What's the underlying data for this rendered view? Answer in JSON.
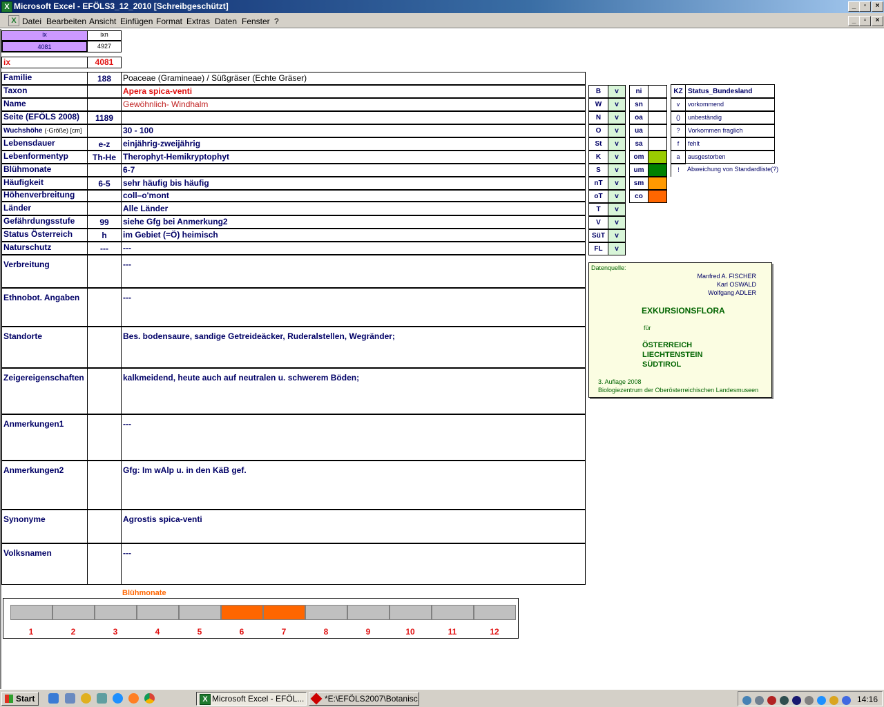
{
  "window": {
    "title": "Microsoft Excel - EFÖLS3_12_2010  [Schreibgeschützt]",
    "btn_min": "_",
    "btn_max": "▫",
    "btn_close": "×"
  },
  "menu": [
    "Datei",
    "Bearbeiten",
    "Ansicht",
    "Einfügen",
    "Format",
    "Extras",
    "Daten",
    "Fenster",
    "?"
  ],
  "header": {
    "ix_label": "ix",
    "ixn_label": "ixn",
    "ix_value": "4081",
    "ixn_value": "4927",
    "ix2_label": "ix",
    "ix2_value": "4081"
  },
  "rows": [
    {
      "label": "Familie",
      "code": "188",
      "value": "Poaceae (Gramineae)  /  Süßgräser (Echte Gräser)"
    },
    {
      "label": "Taxon",
      "code": "",
      "value": "Apera spica-venti"
    },
    {
      "label": "Name",
      "code": "",
      "value": "Gewöhnlich- Windhalm"
    },
    {
      "label": "Seite (EFÖLS 2008)",
      "code": "1189",
      "value": ""
    },
    {
      "label": "Wuchshöhe",
      "label_suffix": "(-Größe) [cm]",
      "code": "",
      "value": " 30 - 100"
    },
    {
      "label": "Lebensdauer",
      "code": "e-z",
      "value": "einjährig-zweijährig"
    },
    {
      "label": "Lebenformentyp",
      "code": "Th-He",
      "value": "Therophyt-Hemikryptophyt"
    },
    {
      "label": "Blühmonate",
      "code": "",
      "value": " 6-7"
    },
    {
      "label": "Häufigkeit",
      "code": "6-5",
      "value": "sehr häufig bis häufig"
    },
    {
      "label": "Höhenverbreitung",
      "code": "",
      "value": "coll–o'mont"
    },
    {
      "label": "Länder",
      "code": "",
      "value": "Alle Länder"
    },
    {
      "label": "Gefährdungsstufe",
      "code": "99",
      "value": "siehe Gfg bei Anmerkung2"
    },
    {
      "label": "Status Österreich",
      "code": "h",
      "value": "im Gebiet (=Ö) heimisch"
    },
    {
      "label": "Naturschutz",
      "code": "---",
      "value": " ---"
    }
  ],
  "big_rows": [
    {
      "label": "Verbreitung",
      "value": " ---"
    },
    {
      "label": "Ethnobot. Angaben",
      "value": "---"
    },
    {
      "label": "Standorte",
      "value": "Bes. bodensaure, sandige Getreideäcker, Ruderalstellen, Wegränder;"
    },
    {
      "label": "Zeigereigenschaften",
      "value": "kalkmeidend, heute auch auf neutralen u. schwerem Böden;"
    },
    {
      "label": "Anmerkungen1",
      "value": "---"
    },
    {
      "label": "Anmerkungen2",
      "value": "Gfg: Im wAlp u. in den KäB gef."
    },
    {
      "label": "Synonyme",
      "value": "Agrostis spica-venti"
    },
    {
      "label": "Volksnamen",
      "value": "---"
    }
  ],
  "states": [
    {
      "code": "B",
      "value": "v"
    },
    {
      "code": "W",
      "value": "v"
    },
    {
      "code": "N",
      "value": "v"
    },
    {
      "code": "O",
      "value": "v"
    },
    {
      "code": "St",
      "value": "v"
    },
    {
      "code": "K",
      "value": "v"
    },
    {
      "code": "S",
      "value": "v"
    },
    {
      "code": "nT",
      "value": "v"
    },
    {
      "code": "oT",
      "value": "v"
    },
    {
      "code": "T",
      "value": "v"
    },
    {
      "code": "V",
      "value": "v"
    },
    {
      "code": "SüT",
      "value": "v"
    },
    {
      "code": "FL",
      "value": "v"
    }
  ],
  "altitude": [
    {
      "code": "ni",
      "color": ""
    },
    {
      "code": "sn",
      "color": ""
    },
    {
      "code": "oa",
      "color": ""
    },
    {
      "code": "ua",
      "color": ""
    },
    {
      "code": "sa",
      "color": ""
    },
    {
      "code": "om",
      "color": "#99cc00"
    },
    {
      "code": "um",
      "color": "#008000"
    },
    {
      "code": "sm",
      "color": "#ff9900"
    },
    {
      "code": "co",
      "color": "#ff6600"
    }
  ],
  "status_legend": {
    "kz_header": "KZ",
    "title": "Status_Bundesland",
    "items": [
      {
        "kz": "v",
        "text": "vorkommend"
      },
      {
        "kz": "()",
        "text": "unbeständig"
      },
      {
        "kz": "?",
        "text": "Vorkommen fraglich"
      },
      {
        "kz": "f",
        "text": "fehlt"
      },
      {
        "kz": "a",
        "text": "ausgestorben"
      },
      {
        "kz": "!",
        "text": "Abweichung von Standardliste(?)"
      }
    ]
  },
  "source": {
    "label": "Datenquelle:",
    "authors": [
      "Manfred A. FISCHER",
      "Karl OSWALD",
      "Wolfgang ADLER"
    ],
    "book": "EXKURSIONSFLORA",
    "fuer": "für",
    "countries": [
      "ÖSTERREICH",
      "LIECHTENSTEIN",
      "SÜDTIROL"
    ],
    "edition": "3. Auflage 2008",
    "publisher": "Biologiezentrum der Oberösterreichischen Landesmuseen"
  },
  "months_chart": {
    "title": "Blühmonate",
    "labels": [
      "1",
      "2",
      "3",
      "4",
      "5",
      "6",
      "7",
      "8",
      "9",
      "10",
      "11",
      "12"
    ],
    "active": [
      6,
      7
    ],
    "active_color": "#ff6600",
    "inactive_color": "#c0c0c0"
  },
  "taskbar": {
    "start": "Start",
    "tasks": [
      "Microsoft Excel - EFÖL...",
      "*E:\\EFÖLS2007\\Botanisc..."
    ],
    "clock": "14:16"
  }
}
